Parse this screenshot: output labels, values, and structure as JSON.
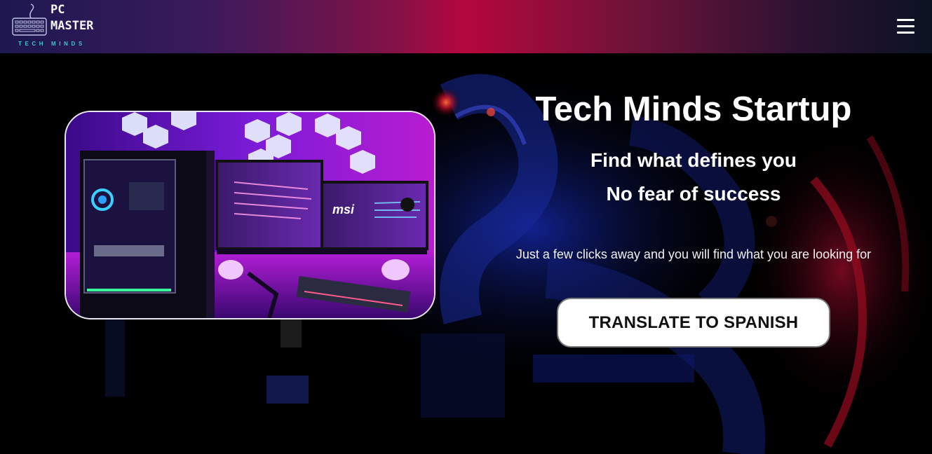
{
  "brand": {
    "line1": "PC",
    "line2": "MASTER",
    "tagline": "TECH MINDS",
    "logo_icon": "keyboard-icon"
  },
  "nav": {
    "menu_icon": "hamburger-menu-icon"
  },
  "hero": {
    "title": "Tech Minds Startup",
    "subtitle_1": "Find what defines you",
    "subtitle_2": "No fear of success",
    "description": "Just a few clicks away and you will find what you are looking for",
    "cta_label": "TRANSLATE TO SPANISH",
    "photo_brand_text": "msi"
  },
  "colors": {
    "header_left": "#1d1850",
    "header_center": "#b5073d",
    "header_right": "#0b1323",
    "logo_tagline": "#43c3c6",
    "page_background": "#000000",
    "button_background": "#ffffff",
    "button_text": "#111111"
  }
}
